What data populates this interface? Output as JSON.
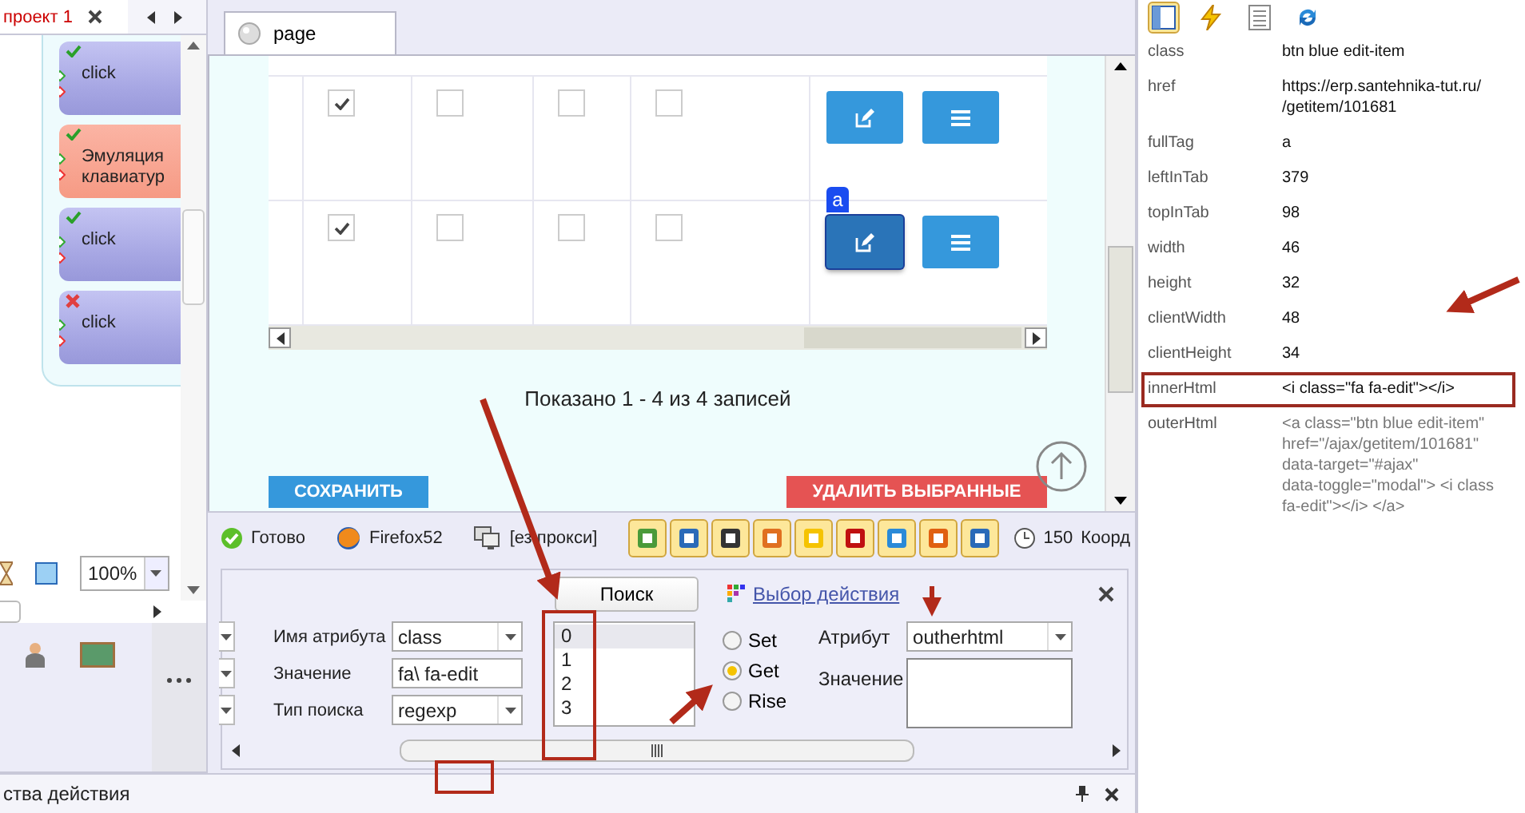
{
  "project_tab": {
    "label": "проект 1",
    "selected": true
  },
  "actions": [
    {
      "kind": "click",
      "passed": true,
      "label": "click"
    },
    {
      "kind": "keyboard",
      "passed": true,
      "label": "Эмуляция клавиатур"
    },
    {
      "kind": "click",
      "passed": true,
      "label": "click"
    },
    {
      "kind": "click",
      "passed": false,
      "label": "click"
    }
  ],
  "zoom": "100%",
  "page_tab": {
    "label": "page"
  },
  "table": {
    "rows": [
      {
        "cells": [
          {
            "checked": true
          },
          {
            "checked": false
          },
          {
            "checked": false
          },
          {
            "checked": false
          }
        ],
        "focused": false
      },
      {
        "cells": [
          {
            "checked": true
          },
          {
            "checked": false
          },
          {
            "checked": false
          },
          {
            "checked": false
          }
        ],
        "focused": true,
        "badge": "a"
      }
    ],
    "summary": "Показано 1 - 4 из 4 записей",
    "buttons": [
      {
        "kind": "save",
        "label": "СОХРАНИТЬ"
      },
      {
        "kind": "delete",
        "label": "УДАЛИТЬ ВЫБРАННЫЕ"
      }
    ]
  },
  "status_bar": [
    {
      "kind": "ok",
      "label": "Готово"
    },
    {
      "kind": "browser",
      "label": "Firefox52"
    },
    {
      "kind": "proxy",
      "label": "[ез прокси]"
    }
  ],
  "timer": "150",
  "coords_label": "Коорд",
  "search_panel": {
    "search_button": "Поиск",
    "action_link": "Выбор действия",
    "fields": [
      {
        "kind": "combo",
        "label": "Имя атрибута",
        "value": "class"
      },
      {
        "kind": "text",
        "label": "Значение",
        "value": "fa\\ fa-edit"
      },
      {
        "kind": "combo",
        "label": "Тип поиска",
        "value": "regexp"
      }
    ],
    "results": [
      {
        "label": "0",
        "selected": true
      },
      {
        "label": "1",
        "selected": false
      },
      {
        "label": "2",
        "selected": false
      },
      {
        "label": "3",
        "selected": false
      }
    ],
    "modes": [
      {
        "label": "Set",
        "selected": false
      },
      {
        "label": "Get",
        "selected": true
      },
      {
        "label": "Rise",
        "selected": false
      }
    ],
    "attribute": {
      "label": "Атрибут",
      "value": "outherhtml"
    },
    "value_label": "Значение"
  },
  "bottom_panel": {
    "title": "ства действия"
  },
  "inspector": {
    "tools": [
      {
        "kind": "properties",
        "selected": true
      },
      {
        "kind": "events",
        "selected": false
      },
      {
        "kind": "list",
        "selected": false
      },
      {
        "kind": "refresh",
        "selected": false
      }
    ],
    "properties": [
      {
        "name": "class",
        "lines": [
          "btn blue edit-item"
        ],
        "highlighted": false,
        "dim": false
      },
      {
        "name": "href",
        "lines": [
          "https://erp.santehnika-tut.ru/",
          "/getitem/101681"
        ],
        "highlighted": false,
        "dim": false
      },
      {
        "name": "fullTag",
        "lines": [
          "a"
        ],
        "highlighted": false,
        "dim": false
      },
      {
        "name": "leftInTab",
        "lines": [
          "379"
        ],
        "highlighted": false,
        "dim": false
      },
      {
        "name": "topInTab",
        "lines": [
          "98"
        ],
        "highlighted": false,
        "dim": false
      },
      {
        "name": "width",
        "lines": [
          "46"
        ],
        "highlighted": false,
        "dim": false
      },
      {
        "name": "height",
        "lines": [
          "32"
        ],
        "highlighted": false,
        "dim": false
      },
      {
        "name": "clientWidth",
        "lines": [
          "48"
        ],
        "highlighted": false,
        "dim": false
      },
      {
        "name": "clientHeight",
        "lines": [
          "34"
        ],
        "highlighted": false,
        "dim": false
      },
      {
        "name": "innerHtml",
        "lines": [
          "<i class=\"fa fa-edit\"></i>"
        ],
        "highlighted": true,
        "dim": false
      },
      {
        "name": "outerHtml",
        "lines": [
          "<a class=\"btn blue edit-item\"",
          "href=\"/ajax/getitem/101681\"",
          "data-target=\"#ajax\"",
          "data-toggle=\"modal\"> <i class",
          "fa-edit\"></i> </a>"
        ],
        "highlighted": false,
        "dim": true
      }
    ]
  }
}
